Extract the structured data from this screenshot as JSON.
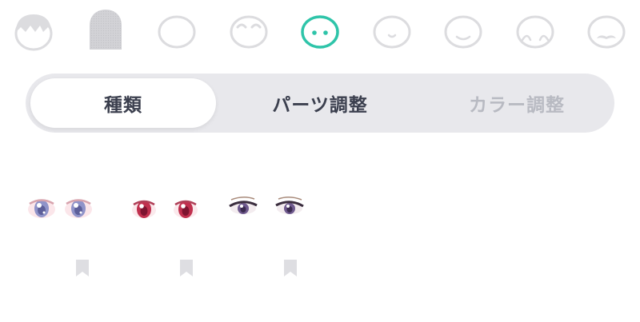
{
  "categories": [
    {
      "icon": "hair-front-icon"
    },
    {
      "icon": "hair-back-icon"
    },
    {
      "icon": "face-outline-icon"
    },
    {
      "icon": "eyebrows-icon"
    },
    {
      "icon": "eyes-icon",
      "selected": true
    },
    {
      "icon": "nose-icon"
    },
    {
      "icon": "mouth-icon"
    },
    {
      "icon": "face-expression-icon"
    },
    {
      "icon": "mustache-icon"
    }
  ],
  "tabs": {
    "type_label": "種類",
    "parts_label": "パーツ調整",
    "color_label": "カラー調整"
  },
  "items": [
    {
      "name": "eye-style-blue-sparkle",
      "iris": "#8f93c9"
    },
    {
      "name": "eye-style-crimson",
      "iris": "#c0304e"
    },
    {
      "name": "eye-style-violet-lashed",
      "iris": "#6f5a8e"
    }
  ],
  "colors": {
    "accent": "#2ec4a9",
    "icon_stroke": "#dcdcdf",
    "tab_track": "#e8e8ec",
    "tab_text": "#3b3f4e",
    "tab_text_disabled": "#b8bac2",
    "bookmark": "#dedee2"
  }
}
